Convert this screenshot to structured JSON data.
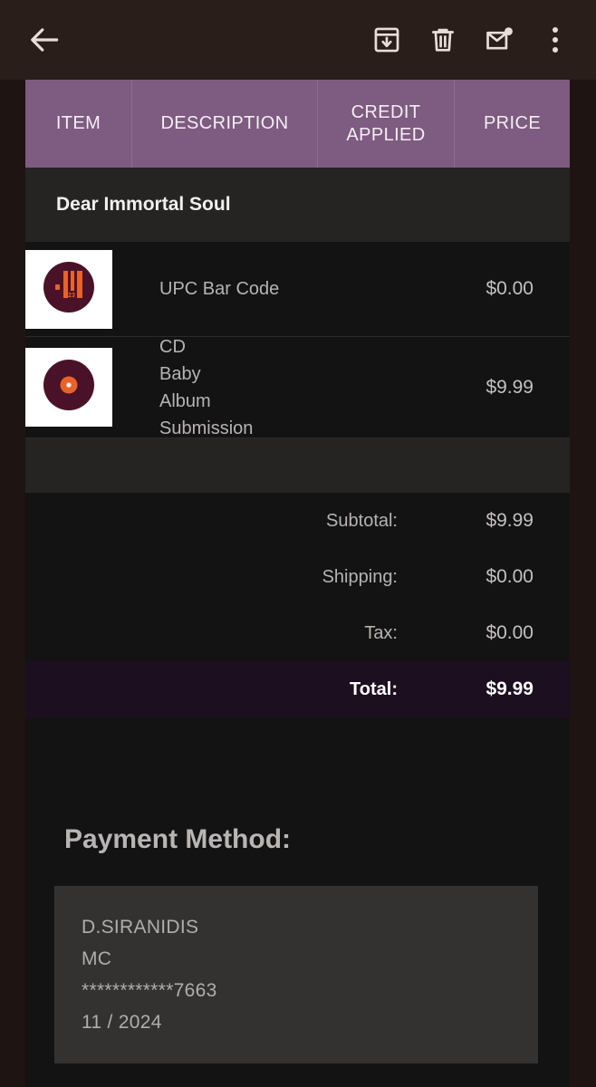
{
  "toolbar": {
    "back_icon": "back-arrow-icon",
    "archive_icon": "archive-icon",
    "delete_icon": "trash-icon",
    "unread_icon": "mark-unread-envelope-icon",
    "overflow_icon": "more-options-icon"
  },
  "invoice": {
    "columns": [
      "ITEM",
      "DESCRIPTION",
      "CREDIT APPLIED",
      "PRICE"
    ],
    "album_title": "Dear Immortal Soul",
    "items": [
      {
        "icon": "upc-barcode-icon",
        "description": "UPC Bar Code",
        "price": "$0.00"
      },
      {
        "icon": "vinyl-record-icon",
        "description": "CD Baby Album Submission",
        "price": "$9.99"
      }
    ],
    "totals": [
      {
        "label": "Subtotal:",
        "value": "$9.99"
      },
      {
        "label": "Shipping:",
        "value": "$0.00"
      },
      {
        "label": "Tax:",
        "value": "$0.00"
      }
    ],
    "grand_total": {
      "label": "Total:",
      "value": "$9.99"
    }
  },
  "payment": {
    "heading": "Payment Method:",
    "name": "D.SIRANIDIS",
    "card_type": "MC",
    "card_number": "************7663",
    "expiry": "11 / 2024"
  },
  "colors": {
    "header_purple": "#7e5b80",
    "total_purple": "#1c0f20",
    "page_bg": "#1e1412",
    "content_bg": "#141313",
    "card_bg": "#333230",
    "accent_orange": "#e8622a",
    "accent_maroon": "#4a1228"
  }
}
